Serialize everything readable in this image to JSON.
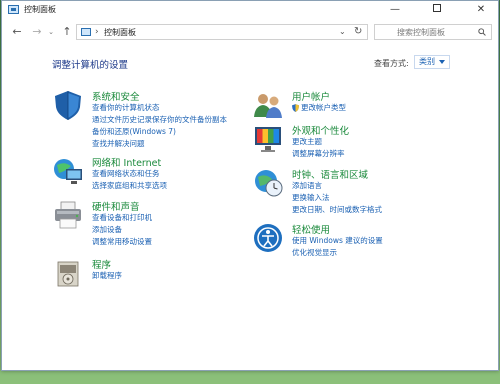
{
  "window": {
    "title": "控制面板",
    "minimize_glyph": "—",
    "close_glyph": "✕"
  },
  "address": {
    "path": "控制面板",
    "separator": "›",
    "search_placeholder": "搜索控制面板"
  },
  "nav": {
    "back_glyph": "←",
    "forward_glyph": "→",
    "history_glyph": "⌄",
    "up_glyph": "↑",
    "dropdown_glyph": "⌄",
    "refresh_glyph": "↻"
  },
  "header": {
    "title": "调整计算机的设置",
    "view_by_label": "查看方式:",
    "view_by_value": "类别"
  },
  "categories": {
    "system_security": {
      "title": "系统和安全",
      "icon": "shield-icon",
      "links": [
        "查看你的计算机状态",
        "通过文件历史记录保存你的文件备份副本",
        "备份和还原(Windows 7)",
        "查找并解决问题"
      ]
    },
    "network": {
      "title": "网络和 Internet",
      "icon": "network-icon",
      "links": [
        "查看网络状态和任务",
        "选择家庭组和共享选项"
      ]
    },
    "hardware": {
      "title": "硬件和声音",
      "icon": "printer-icon",
      "links": [
        "查看设备和打印机",
        "添加设备",
        "调整常用移动设置"
      ]
    },
    "programs": {
      "title": "程序",
      "icon": "programs-icon",
      "links": [
        "卸载程序"
      ]
    },
    "user_accounts": {
      "title": "用户帐户",
      "icon": "users-icon",
      "links": [
        "更改帐户类型"
      ]
    },
    "appearance": {
      "title": "外观和个性化",
      "icon": "appearance-icon",
      "links": [
        "更改主题",
        "调整屏幕分辨率"
      ]
    },
    "clock_region": {
      "title": "时钟、语言和区域",
      "icon": "globe-clock-icon",
      "links": [
        "添加语言",
        "更换输入法",
        "更改日期、时间或数字格式"
      ]
    },
    "ease_of_access": {
      "title": "轻松使用",
      "icon": "ease-of-access-icon",
      "links": [
        "使用 Windows 建议的设置",
        "优化视觉显示"
      ]
    }
  },
  "colors": {
    "category_title": "#1b8a3c",
    "link": "#1b61b3",
    "heading": "#1e3a8a"
  }
}
